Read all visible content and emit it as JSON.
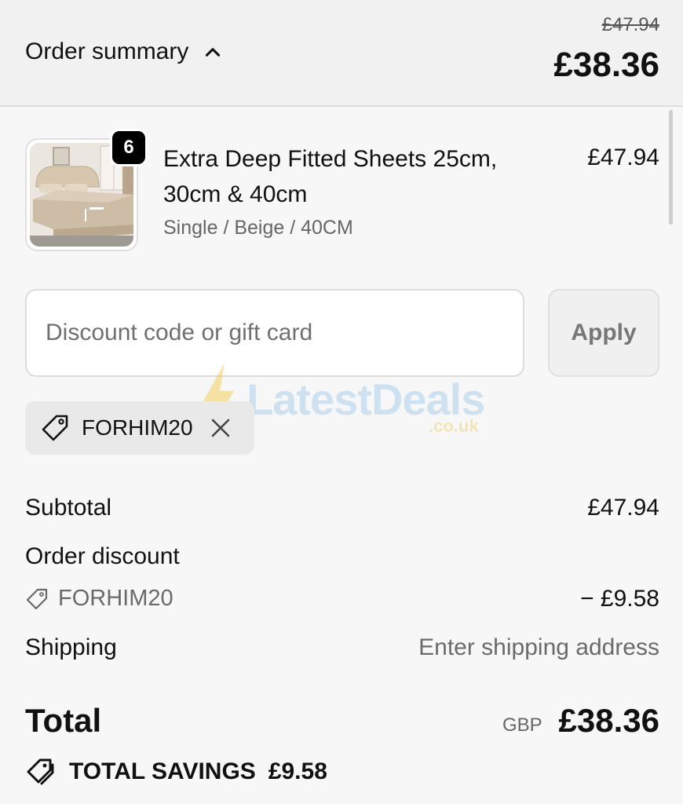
{
  "header": {
    "toggle_label": "Order summary",
    "original_total": "£47.94",
    "total": "£38.36"
  },
  "item": {
    "quantity": "6",
    "name": "Extra Deep Fitted Sheets 25cm, 30cm & 40cm",
    "variant": "Single / Beige / 40CM",
    "price": "£47.94"
  },
  "discount": {
    "placeholder": "Discount code or gift card",
    "apply_label": "Apply",
    "applied_code": "FORHIM20"
  },
  "watermark": {
    "text": "LatestDeals",
    "sub": ".co.uk"
  },
  "summary": {
    "subtotal_label": "Subtotal",
    "subtotal_value": "£47.94",
    "order_discount_label": "Order discount",
    "discount_code": "FORHIM20",
    "discount_value": "− £9.58",
    "shipping_label": "Shipping",
    "shipping_value": "Enter shipping address",
    "total_label": "Total",
    "currency": "GBP",
    "total_value": "£38.36",
    "savings_label": "TOTAL SAVINGS",
    "savings_value": "£9.58"
  },
  "colors": {
    "header_bg": "#f1f1f1",
    "page_bg": "#f7f7f7",
    "chip_bg": "#e9e9e9"
  }
}
